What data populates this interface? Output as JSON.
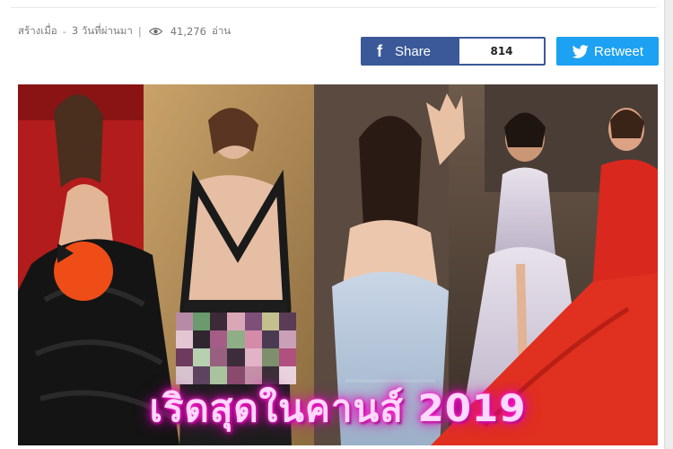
{
  "meta": {
    "created_label": "สร้างเมื่อ",
    "separator": "-",
    "created_ago": "3 วันที่ผ่านมา",
    "divider": "|",
    "views": "41,276",
    "views_unit": "อ่าน",
    "icon": "eye-icon"
  },
  "share": {
    "icon": "facebook-icon",
    "brand_letter": "f",
    "label": "Share",
    "count": "814",
    "color": "#3b5998"
  },
  "retweet": {
    "icon": "twitter-bird-icon",
    "label": "Retweet",
    "color": "#1da1f2"
  },
  "hero": {
    "headline": "เริดสุดในคานส์ 2019",
    "play_icon": "play-icon",
    "play_color": "#ee4d17",
    "mosaic_colors": [
      "#b98aa6",
      "#6a9a6e",
      "#3c2a36",
      "#d9a7b8",
      "#7e4f78",
      "#c4c08e",
      "#5b3c56",
      "#e3c6d2",
      "#2f2630",
      "#a35d86",
      "#8fae88",
      "#d58aa8",
      "#4a3b52",
      "#c9a0b6",
      "#6e3a5e",
      "#b7d0b0",
      "#98607e",
      "#3d2d3a",
      "#e0b4c6",
      "#7d8f6c",
      "#b0507e",
      "#d7c3cf",
      "#5e4360",
      "#a9c39e",
      "#8a4a6e",
      "#c58fa8",
      "#3a3038",
      "#e8d2dc"
    ]
  }
}
